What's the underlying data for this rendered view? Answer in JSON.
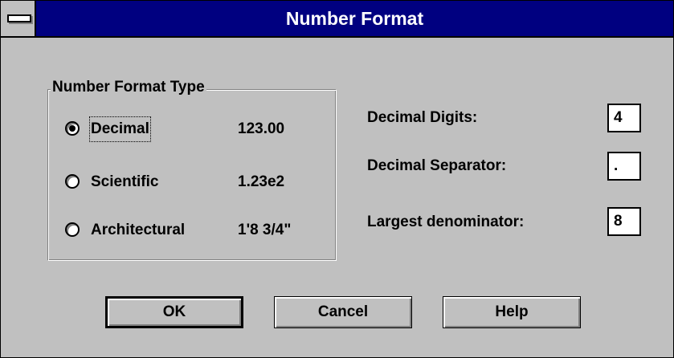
{
  "window": {
    "title": "Number Format"
  },
  "group": {
    "title": "Number Format Type",
    "options": [
      {
        "label": "Decimal",
        "example": "123.00",
        "selected": true
      },
      {
        "label": "Scientific",
        "example": "1.23e2",
        "selected": false
      },
      {
        "label": "Architectural",
        "example": "1'8 3/4\"",
        "selected": false
      }
    ]
  },
  "fields": {
    "decimal_digits": {
      "label": "Decimal Digits:",
      "value": "4"
    },
    "decimal_separator": {
      "label": "Decimal Separator:",
      "value": "."
    },
    "largest_denominator": {
      "label": "Largest denominator:",
      "value": "8"
    }
  },
  "buttons": {
    "ok": "OK",
    "cancel": "Cancel",
    "help": "Help"
  },
  "colors": {
    "title_bar": "#000080",
    "face": "#c0c0c0"
  }
}
